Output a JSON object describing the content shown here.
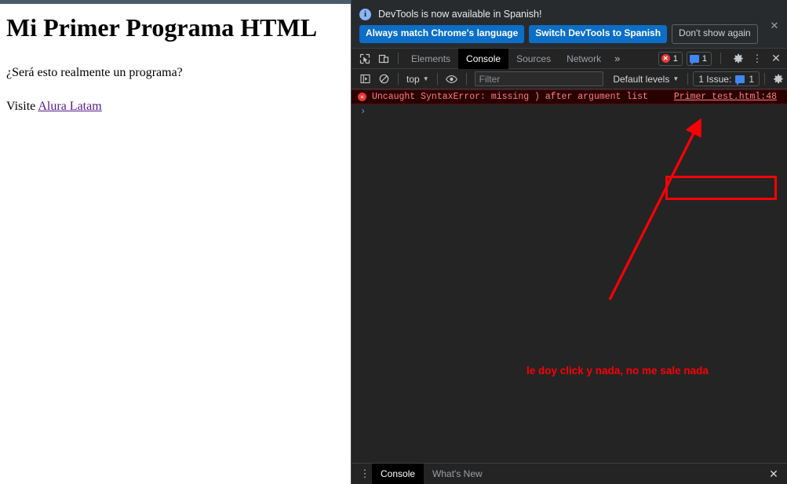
{
  "page": {
    "heading": "Mi Primer Programa HTML",
    "paragraph": "¿Será esto realmente un programa?",
    "visit_prefix": "Visite ",
    "link_label": "Alura Latam"
  },
  "devtools": {
    "banner": {
      "icon": "info-icon",
      "message": "DevTools is now available in Spanish!",
      "buttons": {
        "always_match": "Always match Chrome's language",
        "switch": "Switch DevTools to Spanish",
        "dont_show": "Don't show again"
      },
      "close_glyph": "✕"
    },
    "toolbar": {
      "inspect_icon": "inspect-element-icon",
      "device_icon": "device-toolbar-icon",
      "tabs": [
        {
          "label": "Elements",
          "active": false
        },
        {
          "label": "Console",
          "active": true
        },
        {
          "label": "Sources",
          "active": false
        },
        {
          "label": "Network",
          "active": false
        }
      ],
      "more_tabs_glyph": "»",
      "error_count": "1",
      "message_count": "1",
      "settings_glyph": "✿",
      "kebab_glyph": "⋮",
      "close_glyph": "✕"
    },
    "filterbar": {
      "sidebar_toggle_icon": "console-sidebar-toggle-icon",
      "clear_icon": "clear-console-icon",
      "context": "top",
      "caret": "▼",
      "eye_icon": "live-expression-eye-icon",
      "filter_placeholder": "Filter",
      "filter_value": "",
      "levels": "Default levels",
      "issues_label": "1 Issue:",
      "issues_count": "1",
      "settings_glyph": "✿"
    },
    "console": {
      "error": {
        "badge": "✕",
        "text": "Uncaught SyntaxError: missing ) after argument list",
        "source": "Primer test.html:48"
      },
      "prompt_glyph": "›"
    },
    "annotations": {
      "note": "le doy click y nada, no me sale nada",
      "color": "#fb0007"
    },
    "drawer": {
      "kebab_glyph": "⋮",
      "tabs": [
        {
          "label": "Console",
          "active": true
        },
        {
          "label": "What's New",
          "active": false
        }
      ],
      "close_glyph": "✕"
    }
  }
}
